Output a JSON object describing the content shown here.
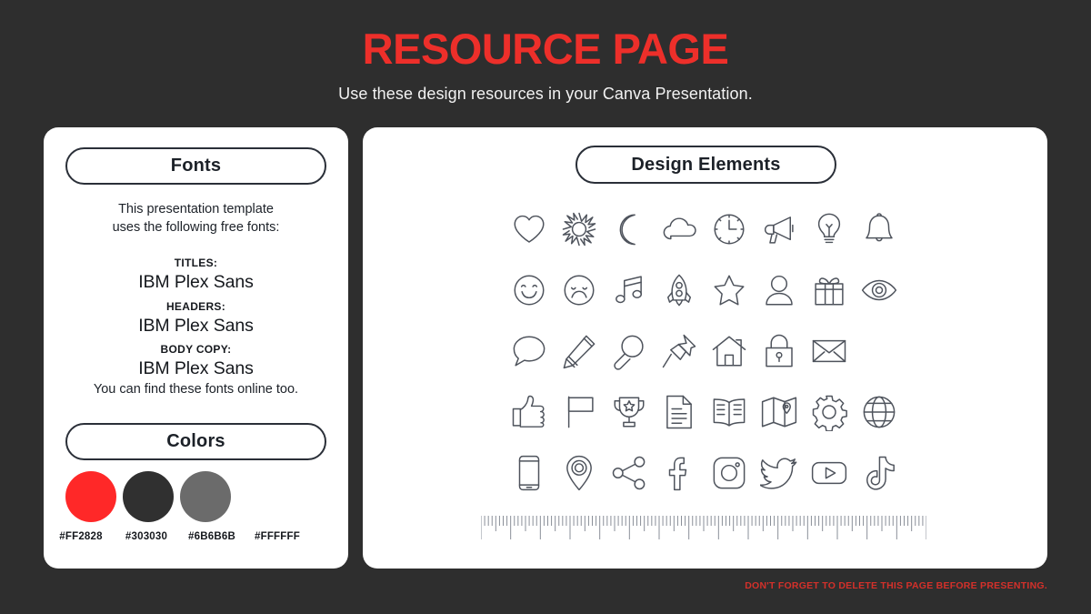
{
  "header": {
    "title": "RESOURCE PAGE",
    "subtitle": "Use these design resources in your Canva Presentation.",
    "title_color": "#ED2F2A"
  },
  "left_card": {
    "fonts": {
      "pill_label": "Fonts",
      "intro": "This presentation template\nuses the following free fonts:",
      "intro_line1": "This presentation template",
      "intro_line2": "uses the following free fonts:",
      "groups": [
        {
          "label": "TITLES:",
          "value": "IBM Plex Sans"
        },
        {
          "label": "HEADERS:",
          "value": "IBM Plex Sans"
        },
        {
          "label": "BODY COPY:",
          "value": "IBM Plex Sans"
        }
      ],
      "outro": "You can find these fonts online too."
    },
    "colors": {
      "pill_label": "Colors",
      "swatches": [
        {
          "hex": "#FF2828",
          "label": "#FF2828"
        },
        {
          "hex": "#303030",
          "label": "#303030"
        },
        {
          "hex": "#6B6B6B",
          "label": "#6B6B6B"
        },
        {
          "hex": "#FFFFFF",
          "label": "#FFFFFF"
        }
      ]
    }
  },
  "right_card": {
    "pill_label": "Design Elements",
    "icon_rows": [
      [
        "heart-icon",
        "sun-icon",
        "moon-icon",
        "cloud-icon",
        "clock-icon",
        "megaphone-icon",
        "lightbulb-icon",
        "bell-icon"
      ],
      [
        "smiley-happy-icon",
        "smiley-sad-icon",
        "music-note-icon",
        "rocket-icon",
        "star-icon",
        "person-icon",
        "gift-icon",
        "eye-icon"
      ],
      [
        "speech-bubble-icon",
        "pencil-icon",
        "magnifier-icon",
        "pushpin-icon",
        "house-icon",
        "lock-icon",
        "envelope-icon"
      ],
      [
        "thumbs-up-icon",
        "flag-icon",
        "trophy-icon",
        "document-icon",
        "book-icon",
        "map-icon",
        "gear-icon",
        "globe-icon"
      ],
      [
        "smartphone-icon",
        "location-pin-icon",
        "share-icon",
        "facebook-icon",
        "instagram-icon",
        "twitter-icon",
        "youtube-icon",
        "tiktok-icon"
      ]
    ],
    "ruler": {
      "name": "ruler-graphic",
      "major_tick_interval": 8,
      "total_ticks": 120
    }
  },
  "footer": {
    "note": "DON'T FORGET TO DELETE THIS PAGE BEFORE PRESENTING."
  }
}
